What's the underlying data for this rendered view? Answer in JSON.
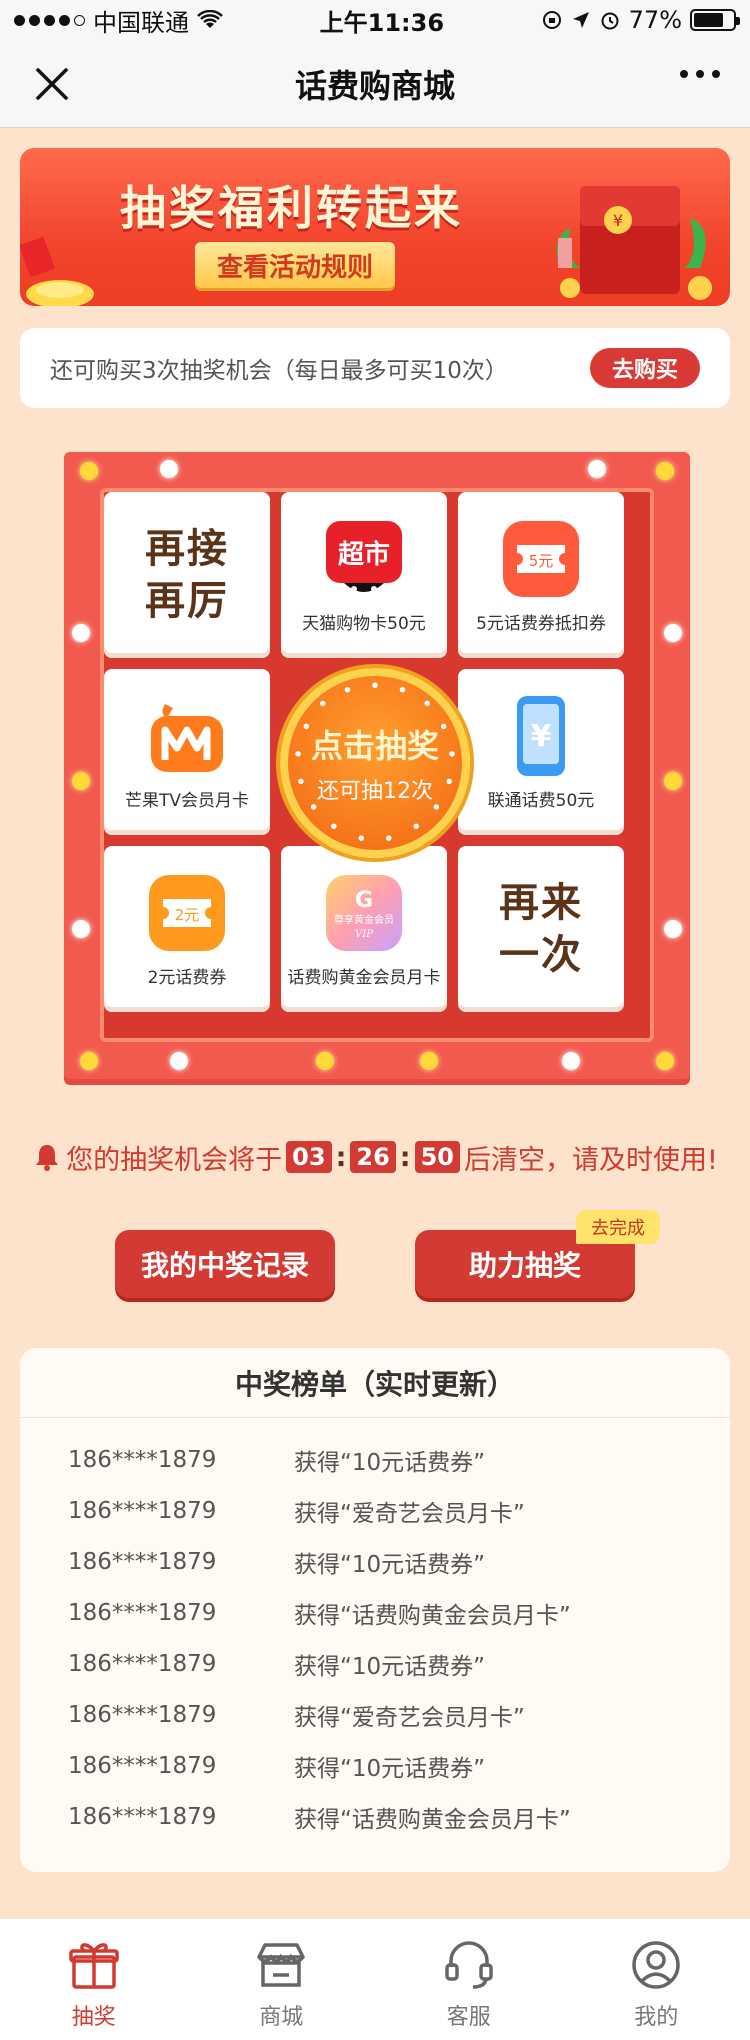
{
  "status_bar": {
    "carrier": "中国联通",
    "time": "上午11:36",
    "battery_percent": "77%"
  },
  "nav": {
    "title": "话费购商城",
    "close_icon": "close-icon",
    "more_icon": "more-icon"
  },
  "banner": {
    "title": "抽奖福利转起来",
    "rules_button": "查看活动规则"
  },
  "purchase": {
    "text": "还可购买3次抽奖机会（每日最多可买10次）",
    "button": "去购买"
  },
  "lottery": {
    "cells": [
      {
        "type": "text",
        "text": "再接再厉"
      },
      {
        "type": "prize",
        "badge_text": "超市",
        "label": "天猫购物卡50元"
      },
      {
        "type": "prize",
        "badge_text": "5元",
        "label": "5元话费券抵扣券"
      },
      {
        "type": "prize",
        "label": "芒果TV会员月卡"
      },
      {
        "type": "prize",
        "badge_text": "¥",
        "label": "联通话费50元"
      },
      {
        "type": "prize",
        "badge_text": "2元",
        "label": "2元话费券"
      },
      {
        "type": "prize",
        "badge_text": "尊享黄金会员",
        "label": "话费购黄金会员月卡"
      },
      {
        "type": "text",
        "text": "再来一次"
      }
    ],
    "center_button": {
      "title": "点击抽奖",
      "subtitle": "还可抽12次"
    }
  },
  "countdown": {
    "prefix": "您的抽奖机会将于",
    "hours": "03",
    "minutes": "26",
    "seconds": "50",
    "suffix": "后清空，请及时使用!"
  },
  "actions": {
    "records_button": "我的中奖记录",
    "assist_button": "助力抽奖",
    "assist_badge": "去完成"
  },
  "leaderboard": {
    "title": "中奖榜单（实时更新）",
    "rows": [
      {
        "phone": "186****1879",
        "prize": "获得“10元话费券”"
      },
      {
        "phone": "186****1879",
        "prize": "获得“爱奇艺会员月卡”"
      },
      {
        "phone": "186****1879",
        "prize": "获得“10元话费券”"
      },
      {
        "phone": "186****1879",
        "prize": "获得“话费购黄金会员月卡”"
      },
      {
        "phone": "186****1879",
        "prize": "获得“10元话费券”"
      },
      {
        "phone": "186****1879",
        "prize": "获得“爱奇艺会员月卡”"
      },
      {
        "phone": "186****1879",
        "prize": "获得“10元话费券”"
      },
      {
        "phone": "186****1879",
        "prize": "获得“话费购黄金会员月卡”"
      }
    ]
  },
  "tabs": [
    {
      "label": "抽奖",
      "icon": "gift-icon",
      "active": true
    },
    {
      "label": "商城",
      "icon": "store-icon",
      "active": false
    },
    {
      "label": "客服",
      "icon": "headset-icon",
      "active": false
    },
    {
      "label": "我的",
      "icon": "user-icon",
      "active": false
    }
  ],
  "colors": {
    "background": "#fde3cb",
    "accent_red": "#d33a34",
    "board_red": "#f25a4f",
    "gold": "#ffd24d"
  }
}
